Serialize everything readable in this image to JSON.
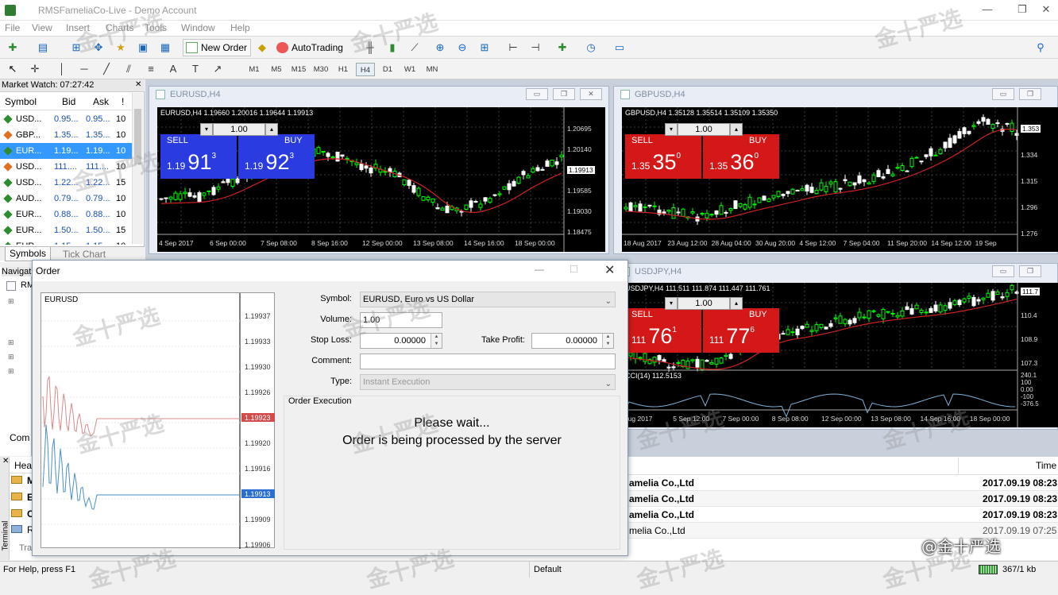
{
  "window": {
    "title": "RMSFameliaCo-Live - Demo Account"
  },
  "menu": [
    "File",
    "View",
    "Insert",
    "Charts",
    "Tools",
    "Window",
    "Help"
  ],
  "toolbar": {
    "new_order": "New Order",
    "autotrading": "AutoTrading"
  },
  "timeframes": [
    "M1",
    "M5",
    "M15",
    "M30",
    "H1",
    "H4",
    "D1",
    "W1",
    "MN"
  ],
  "timeframe_selected": "H4",
  "market_watch": {
    "title": "Market Watch: 07:27:42",
    "cols": [
      "Symbol",
      "Bid",
      "Ask",
      "!"
    ],
    "rows": [
      {
        "sym": "USD...",
        "bid": "0.95...",
        "ask": "0.95...",
        "spr": "10",
        "color": "#2e8b2e"
      },
      {
        "sym": "GBP...",
        "bid": "1.35...",
        "ask": "1.35...",
        "spr": "10",
        "color": "#e07020"
      },
      {
        "sym": "EUR...",
        "bid": "1.19...",
        "ask": "1.19...",
        "spr": "10",
        "color": "#2e8b2e"
      },
      {
        "sym": "USD...",
        "bid": "111....",
        "ask": "111....",
        "spr": "10",
        "color": "#e07020"
      },
      {
        "sym": "USD...",
        "bid": "1.22...",
        "ask": "1.22...",
        "spr": "15",
        "color": "#2e8b2e"
      },
      {
        "sym": "AUD...",
        "bid": "0.79...",
        "ask": "0.79...",
        "spr": "10",
        "color": "#2e8b2e"
      },
      {
        "sym": "EUR...",
        "bid": "0.88...",
        "ask": "0.88...",
        "spr": "10",
        "color": "#2e8b2e"
      },
      {
        "sym": "EUR...",
        "bid": "1.50...",
        "ask": "1.50...",
        "spr": "15",
        "color": "#2e8b2e"
      },
      {
        "sym": "EUR...",
        "bid": "1.15...",
        "ask": "1.15...",
        "spr": "10",
        "color": "#2e8b2e"
      }
    ],
    "selected_row": 2,
    "tabs": [
      "Symbols",
      "Tick Chart"
    ]
  },
  "navigator": {
    "title": "Navigat",
    "item": "RM",
    "common_tab": "Com"
  },
  "charts": {
    "eurusd": {
      "title": "EURUSD,H4",
      "info": "EURUSD,H4  1.19660 1.20016 1.19644 1.19913",
      "sell": "SELL",
      "buy": "BUY",
      "lot": "1.00",
      "sell_small": "1.19",
      "sell_big": "91",
      "sell_sup": "3",
      "buy_small": "1.19",
      "buy_big": "92",
      "buy_sup": "3",
      "prices": [
        "1.20695",
        "1.20140",
        "1.19913",
        "1.19585",
        "1.19030",
        "1.18475"
      ],
      "times": [
        "4 Sep 2017",
        "6 Sep 00:00",
        "7 Sep 08:00",
        "8 Sep 16:00",
        "12 Sep 00:00",
        "13 Sep 08:00",
        "14 Sep 16:00",
        "18 Sep 00:00"
      ]
    },
    "gbpusd": {
      "title": "GBPUSD,H4",
      "info": "GBPUSD,H4  1.35128 1.35514 1.35109 1.35350",
      "sell": "SELL",
      "buy": "BUY",
      "lot": "1.00",
      "sell_small": "1.35",
      "sell_big": "35",
      "sell_sup": "0",
      "buy_small": "1.35",
      "buy_big": "36",
      "buy_sup": "0",
      "prices": [
        "1.353",
        "1.334",
        "1.315",
        "1.296",
        "1.276"
      ],
      "times": [
        "18 Aug 2017",
        "23 Aug 12:00",
        "28 Aug 04:00",
        "30 Aug 20:00",
        "4 Sep 12:00",
        "7 Sep 04:00",
        "11 Sep 20:00",
        "14 Sep 12:00",
        "19 Sep"
      ]
    },
    "usdjpy": {
      "title": "USDJPY,H4",
      "info": "USDJPY,H4  111.511 111.874 111.447 111.761",
      "sell": "SELL",
      "buy": "BUY",
      "lot": "1.00",
      "sell_small": "111",
      "sell_big": "76",
      "sell_sup": "1",
      "buy_small": "111",
      "buy_big": "77",
      "buy_sup": "6",
      "cci": "CCI(14) 112.5153",
      "prices": [
        "111.7",
        "110.4",
        "108.9",
        "107.3"
      ],
      "cci_prices": [
        "240.1",
        "100",
        "0.00",
        "-100",
        "-376.5"
      ],
      "times": [
        "Aug 2017",
        "5 Sep 12:00",
        "7 Sep 00:00",
        "8 Sep 08:00",
        "12 Sep 00:00",
        "13 Sep 08:00",
        "14 Sep 16:00",
        "18 Sep 00:00"
      ]
    }
  },
  "order": {
    "title": "Order",
    "mini_symbol": "EURUSD",
    "mini_prices": [
      "1.19937",
      "1.19933",
      "1.19930",
      "1.19926",
      "1.19923",
      "1.19920",
      "1.19916",
      "1.19913",
      "1.19909",
      "1.19906"
    ],
    "symbol_label": "Symbol:",
    "symbol_value": "EURUSD, Euro vs US Dollar",
    "volume_label": "Volume:",
    "volume_value": "1.00",
    "sl_label": "Stop Loss:",
    "sl_value": "0.00000",
    "tp_label": "Take Profit:",
    "tp_value": "0.00000",
    "comment_label": "Comment:",
    "comment_value": "",
    "type_label": "Type:",
    "type_value": "Instant Execution",
    "exec_label": "Order Execution",
    "wait1": "Please wait...",
    "wait2": "Order is being processed by the server"
  },
  "terminal": {
    "header_partial": "Hea",
    "time_col": "Time",
    "side_label": "Terminal",
    "bottom_tab": "Tra",
    "rows": [
      {
        "from": "amelia Co.,Ltd",
        "time": "2017.09.19 08:23",
        "bold": true
      },
      {
        "from": "amelia Co.,Ltd",
        "time": "2017.09.19 08:23",
        "bold": true
      },
      {
        "from": "amelia Co.,Ltd",
        "time": "2017.09.19 08:23",
        "bold": true
      },
      {
        "from": "melia Co.,Ltd",
        "time": "2017.09.19 07:25",
        "bold": false
      }
    ],
    "left_icons": [
      "M",
      "E",
      "C",
      "R"
    ]
  },
  "status": {
    "help": "For Help, press F1",
    "profile": "Default",
    "traffic": "367/1 kb"
  },
  "watermark": "金十严选",
  "watermark_handle": "@金十严选",
  "colors": {
    "chart_bg": "#000000",
    "bull": "#00ff00",
    "bear": "#ffffff",
    "ma": "#cc2222",
    "sell_panel_eur": "#2233dd",
    "sell_panel_gbp": "#cc1111"
  }
}
